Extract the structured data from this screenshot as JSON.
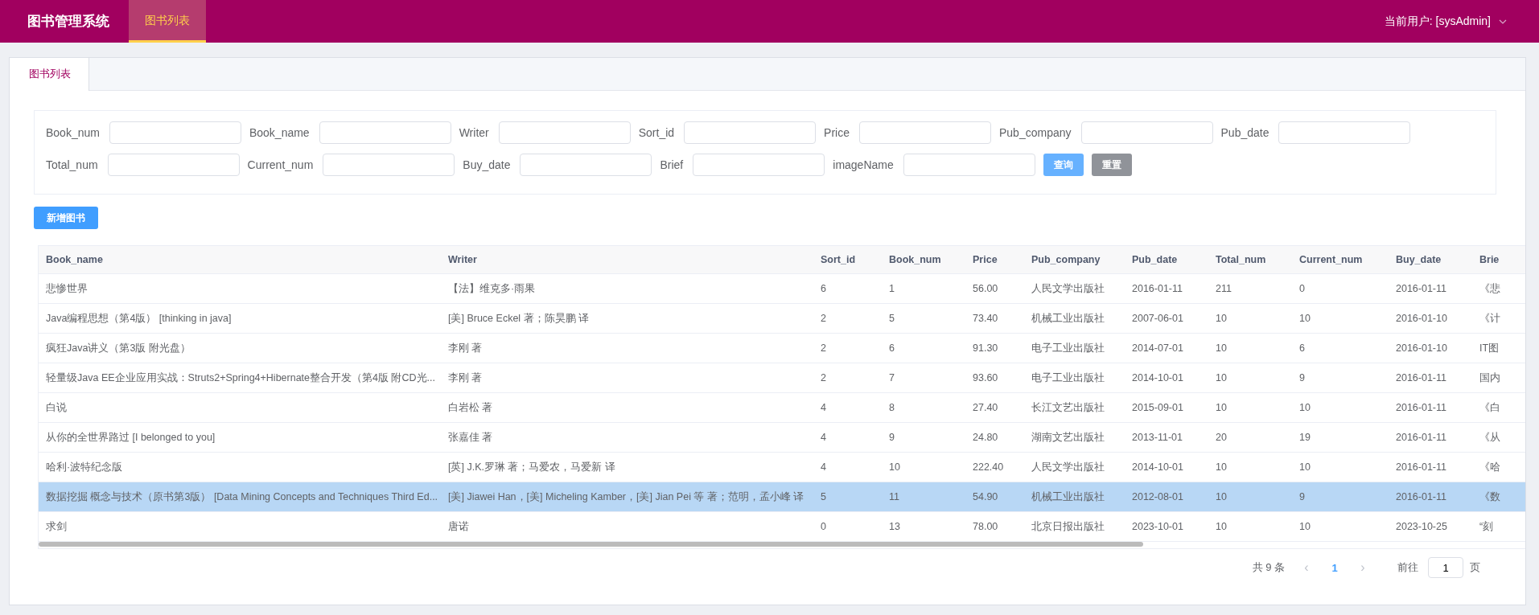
{
  "header": {
    "title": "图书管理系统",
    "nav": [
      {
        "label": "图书列表",
        "selected": true
      }
    ],
    "user": "当前用户: [sysAdmin]"
  },
  "tabs": [
    {
      "label": "图书列表",
      "selected": true
    }
  ],
  "form": {
    "rows": [
      [
        {
          "label": "Book_num"
        },
        {
          "label": "Book_name"
        },
        {
          "label": "Writer"
        },
        {
          "label": "Sort_id"
        },
        {
          "label": "Price"
        },
        {
          "label": "Pub_company"
        },
        {
          "label": "Pub_date"
        }
      ],
      [
        {
          "label": "Total_num"
        },
        {
          "label": "Current_num"
        },
        {
          "label": "Buy_date"
        },
        {
          "label": "Brief"
        },
        {
          "label": "imageName"
        }
      ]
    ],
    "buttons": [
      {
        "label": "查询",
        "kind": "primary"
      },
      {
        "label": "重置",
        "kind": "secondary"
      }
    ]
  },
  "add_button": "新增图书",
  "table": {
    "columns": [
      "Book_name",
      "Writer",
      "Sort_id",
      "Book_num",
      "Price",
      "Pub_company",
      "Pub_date",
      "Total_num",
      "Current_num",
      "Buy_date",
      "Brie"
    ],
    "rows": [
      {
        "selected": false,
        "cells": [
          "悲惨世界",
          "【法】维克多·雨果",
          "6",
          "1",
          "56.00",
          "人民文学出版社",
          "2016-01-11",
          "211",
          "0",
          "2016-01-11",
          "《悲"
        ]
      },
      {
        "selected": false,
        "cells": [
          "Java编程思想（第4版） [thinking in java]",
          "[美] Bruce Eckel 著；陈昊鹏 译",
          "2",
          "5",
          "73.40",
          "机械工业出版社",
          "2007-06-01",
          "10",
          "10",
          "2016-01-10",
          "《计"
        ]
      },
      {
        "selected": false,
        "cells": [
          "疯狂Java讲义（第3版 附光盘）",
          "李刚 著",
          "2",
          "6",
          "91.30",
          "电子工业出版社",
          "2014-07-01",
          "10",
          "6",
          "2016-01-10",
          "IT图"
        ]
      },
      {
        "selected": false,
        "cells": [
          "轻量级Java EE企业应用实战：Struts2+Spring4+Hibernate整合开发（第4版 附CD光...",
          "李刚 著",
          "2",
          "7",
          "93.60",
          "电子工业出版社",
          "2014-10-01",
          "10",
          "9",
          "2016-01-11",
          "国内"
        ]
      },
      {
        "selected": false,
        "cells": [
          "白说",
          "白岩松 著",
          "4",
          "8",
          "27.40",
          "长江文艺出版社",
          "2015-09-01",
          "10",
          "10",
          "2016-01-11",
          "《白"
        ]
      },
      {
        "selected": false,
        "cells": [
          "从你的全世界路过 [I belonged to you]",
          "张嘉佳 著",
          "4",
          "9",
          "24.80",
          "湖南文艺出版社",
          "2013-11-01",
          "20",
          "19",
          "2016-01-11",
          "《从"
        ]
      },
      {
        "selected": false,
        "cells": [
          "哈利·波特纪念版",
          "[英] J.K.罗琳 著；马爱农，马爱新 译",
          "4",
          "10",
          "222.40",
          "人民文学出版社",
          "2014-10-01",
          "10",
          "10",
          "2016-01-11",
          "《哈"
        ]
      },
      {
        "selected": true,
        "cells": [
          "数据挖掘 概念与技术（原书第3版） [Data Mining Concepts and Techniques Third Ed...",
          "[美] Jiawei Han，[美] Micheling Kamber，[美] Jian Pei 等 著；范明，孟小峰 译",
          "5",
          "11",
          "54.90",
          "机械工业出版社",
          "2012-08-01",
          "10",
          "9",
          "2016-01-11",
          "《数"
        ]
      },
      {
        "selected": false,
        "cells": [
          "求剑",
          "唐诺",
          "0",
          "13",
          "78.00",
          "北京日报出版社",
          "2023-10-01",
          "10",
          "10",
          "2023-10-25",
          "“刻"
        ]
      }
    ]
  },
  "pagination": {
    "total": "共 9 条",
    "prev": "‹",
    "pages": [
      {
        "label": "1",
        "selected": true
      }
    ],
    "next": "›",
    "goto": "前往",
    "page_value": "1",
    "page_unit": "页"
  }
}
